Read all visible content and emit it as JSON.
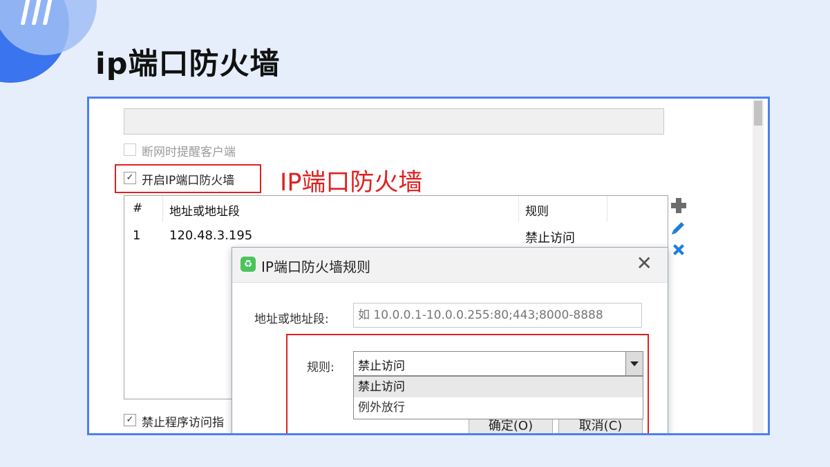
{
  "page": {
    "title": "ip端口防火墙"
  },
  "panel": {
    "disconnect_reminder": "断网时提醒客户端",
    "enable_firewall": "开启IP端口防火墙",
    "annotation": "IP端口防火墙",
    "block_program_access": "禁止程序访问指"
  },
  "table": {
    "columns": [
      "#",
      "地址或地址段",
      "规则"
    ],
    "rows": [
      {
        "num": "1",
        "address": "120.48.3.195",
        "rule": "禁止访问"
      }
    ]
  },
  "tools": {
    "add_icon": "plus-icon",
    "edit_icon": "pencil-icon",
    "delete_icon": "close-icon"
  },
  "dialog": {
    "title": "IP端口防火墙规则",
    "address_label": "地址或地址段:",
    "address_placeholder": "如 10.0.0.1-10.0.0.255:80;443;8000-8888",
    "rule_label": "规则:",
    "rule_value": "禁止访问",
    "rule_options": [
      "禁止访问",
      "例外放行"
    ],
    "ok_label": "确定(O)",
    "cancel_label": "取消(C)"
  },
  "colors": {
    "accent": "#4d7ff0",
    "highlight_red": "#e02020",
    "page_bg": "#e6eefb",
    "tool_blue": "#1e7fd6"
  }
}
